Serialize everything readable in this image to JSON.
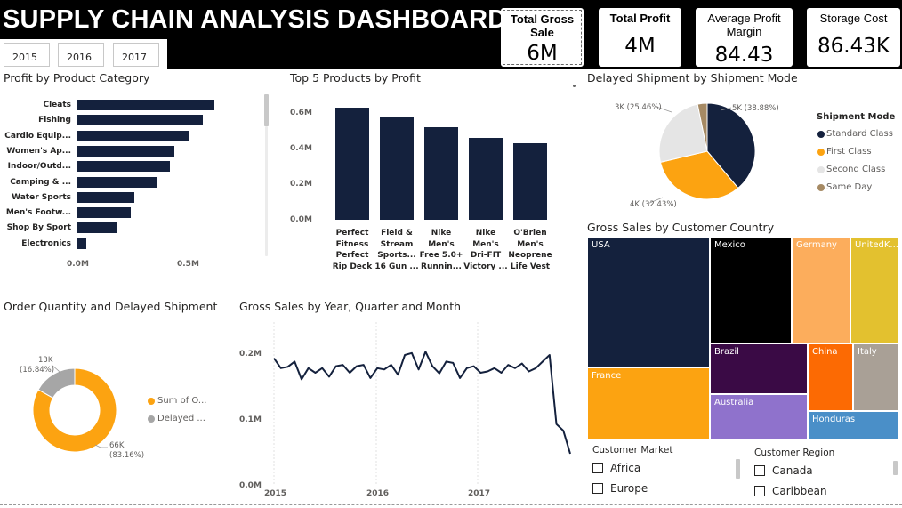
{
  "header": {
    "title": "SUPPLY CHAIN ANALYSIS DASHBOARD",
    "year_buttons": [
      "2015",
      "2016",
      "2017"
    ]
  },
  "kpis": [
    {
      "label": "Total Gross Sale",
      "value": "6M",
      "bold": true
    },
    {
      "label": "Total Profit",
      "value": "4M",
      "bold": true
    },
    {
      "label": "Average Profit Margin",
      "value": "84.43",
      "bold": false
    },
    {
      "label": "Storage Cost",
      "value": "86.43K",
      "bold": false
    }
  ],
  "profit_by_category": {
    "title": "Profit by Product Category",
    "chart_data": {
      "type": "bar",
      "orientation": "horizontal",
      "categories": [
        "Cleats",
        "Fishing",
        "Cardio Equip...",
        "Women's Ap...",
        "Indoor/Outd...",
        "Camping & ...",
        "Water Sports",
        "Men's Footw...",
        "Shop By Sport",
        "Electronics"
      ],
      "values": [
        0.62,
        0.57,
        0.51,
        0.44,
        0.42,
        0.36,
        0.26,
        0.24,
        0.18,
        0.04
      ],
      "xticks": [
        "0.0M",
        "0.5M"
      ],
      "xlim": [
        0,
        0.5
      ],
      "color": "#14213d"
    }
  },
  "top5_products": {
    "title": "Top 5 Products by Profit",
    "chart_data": {
      "type": "bar",
      "categories": [
        "Perfect\nFitness\nPerfect\nRip Deck",
        "Field &\nStream\nSports...\n16 Gun ...",
        "Nike\nMen's\nFree 5.0+\nRunnin...",
        "Nike\nMen's\nDri-FIT\nVictory ...",
        "O'Brien\nMen's\nNeoprene\nLife Vest"
      ],
      "values": [
        0.63,
        0.58,
        0.52,
        0.46,
        0.43
      ],
      "yticks": [
        "0.6M",
        "0.4M",
        "0.2M",
        "0.0M"
      ],
      "ylim": [
        0,
        0.6
      ],
      "color": "#14213d"
    }
  },
  "delayed_by_mode": {
    "title": "Delayed Shipment by Shipment Mode",
    "legend_title": "Shipment Mode",
    "chart_data": {
      "type": "pie",
      "slices": [
        {
          "name": "Standard Class",
          "value": 38.88,
          "color": "#14213d",
          "label": "5K (38.88%)"
        },
        {
          "name": "First Class",
          "value": 32.43,
          "color": "#fca311",
          "label": "4K (32.43%)"
        },
        {
          "name": "Second Class",
          "value": 25.46,
          "color": "#e5e5e5",
          "label": "3K (25.46%)"
        },
        {
          "name": "Same Day",
          "value": 3.23,
          "color": "#a68a64",
          "label": ""
        }
      ]
    }
  },
  "gross_by_country": {
    "title": "Gross Sales by Customer Country",
    "cells": [
      {
        "name": "USA",
        "color": "#14213d"
      },
      {
        "name": "Mexico",
        "color": "#000000"
      },
      {
        "name": "Germany",
        "color": "#fcad5c"
      },
      {
        "name": "UnitedK...",
        "color": "#e3c12f"
      },
      {
        "name": "France",
        "color": "#fca311"
      },
      {
        "name": "Brazil",
        "color": "#3a0a45"
      },
      {
        "name": "China",
        "color": "#fc6a03"
      },
      {
        "name": "Italy",
        "color": "#a9a096"
      },
      {
        "name": "Australia",
        "color": "#8f72cc"
      },
      {
        "name": "Honduras",
        "color": "#4a8fc8"
      }
    ]
  },
  "order_qty_delayed": {
    "title": "Order Quantity and Delayed Shipment",
    "chart_data": {
      "type": "pie",
      "donut": true,
      "slices": [
        {
          "name": "Sum of O...",
          "value": 83.16,
          "color": "#fca311",
          "label_value": "66K",
          "label_pct": "(83.16%)"
        },
        {
          "name": "Delayed ...",
          "value": 16.84,
          "color": "#a6a6a6",
          "label_value": "13K",
          "label_pct": "(16.84%)"
        }
      ]
    }
  },
  "gross_by_time": {
    "title": "Gross Sales by Year, Quarter and Month",
    "chart_data": {
      "type": "line",
      "xticks": [
        "2015",
        "2016",
        "2017"
      ],
      "yticks": [
        "0.2M",
        "0.1M",
        "0.0M"
      ],
      "ylim": [
        0,
        0.2
      ],
      "y": [
        0.195,
        0.18,
        0.182,
        0.19,
        0.163,
        0.18,
        0.173,
        0.18,
        0.167,
        0.183,
        0.185,
        0.173,
        0.183,
        0.185,
        0.165,
        0.18,
        0.178,
        0.185,
        0.17,
        0.2,
        0.203,
        0.178,
        0.205,
        0.183,
        0.172,
        0.19,
        0.188,
        0.165,
        0.18,
        0.183,
        0.173,
        0.175,
        0.18,
        0.173,
        0.185,
        0.18,
        0.187,
        0.175,
        0.18,
        0.19,
        0.2,
        0.095,
        0.085,
        0.05
      ],
      "color": "#14213d"
    }
  },
  "slicers": {
    "market": {
      "title": "Customer Market",
      "items": [
        "Africa",
        "Europe"
      ]
    },
    "region": {
      "title": "Customer Region",
      "items": [
        "Canada",
        "Caribbean"
      ]
    }
  }
}
